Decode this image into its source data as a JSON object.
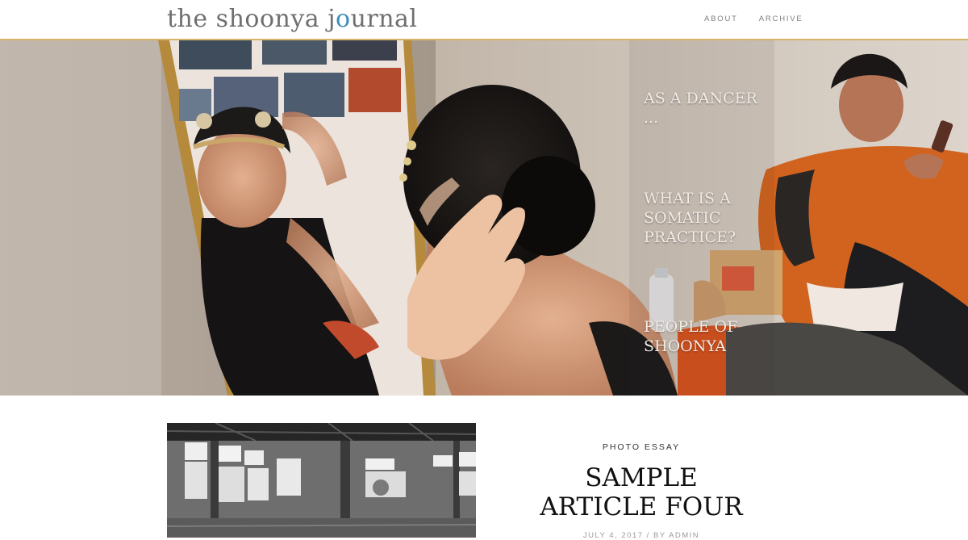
{
  "header": {
    "logo_prefix": "the shoonya j",
    "logo_accent": "o",
    "logo_suffix": "urnal",
    "nav": [
      {
        "label": "ABOUT"
      },
      {
        "label": "ARCHIVE"
      }
    ]
  },
  "hero": {
    "links": [
      {
        "label": "AS A DANCER ..."
      },
      {
        "label": "WHAT IS A SOMATIC PRACTICE?"
      },
      {
        "label": "PEOPLE OF SHOONYA"
      }
    ]
  },
  "article": {
    "category": "PHOTO ESSAY",
    "title": "SAMPLE ARTICLE FOUR",
    "date": "JULY 4, 2017",
    "separator": "/",
    "author": "BY ADMIN"
  },
  "colors": {
    "logo_text": "#6f6f6f",
    "logo_accent": "#3d8fb5",
    "header_rule": "#d8b46a"
  }
}
